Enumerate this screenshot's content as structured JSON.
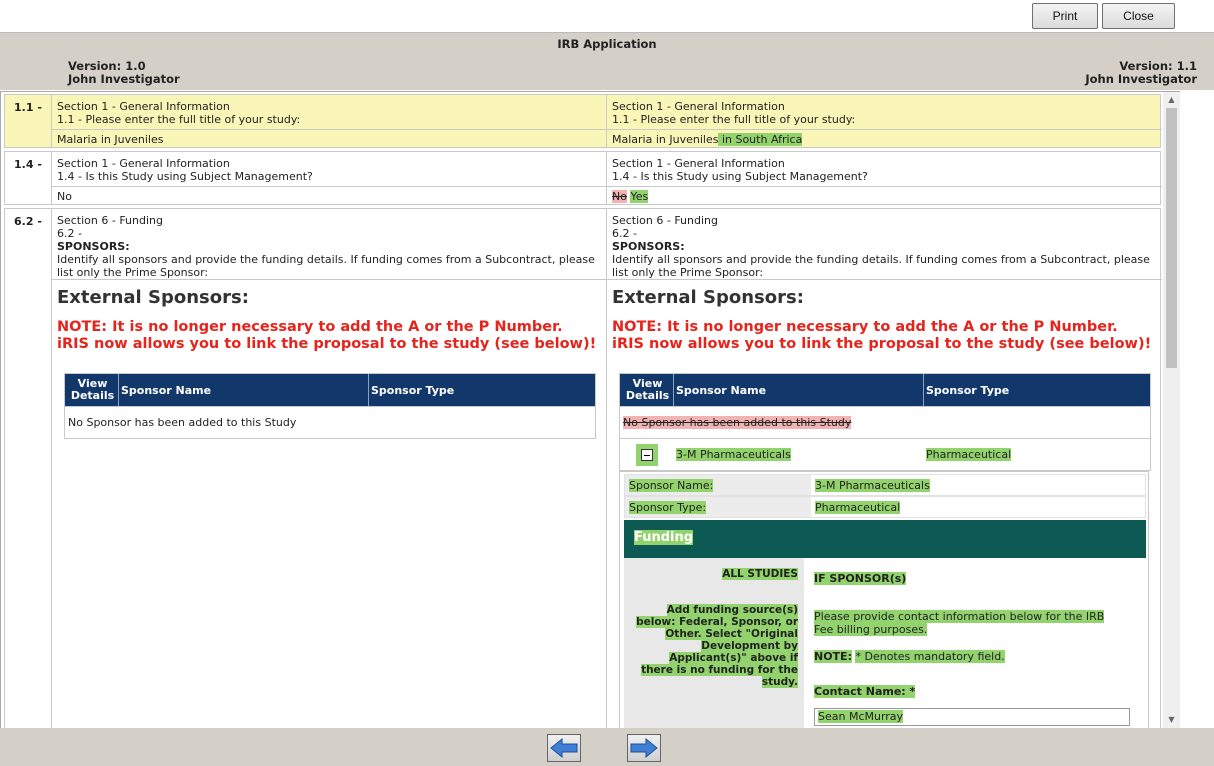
{
  "toolbar": {
    "print_label": "Print",
    "close_label": "Close"
  },
  "header": {
    "title": "IRB Application",
    "left_version": "Version: 1.0",
    "left_user": "John Investigator",
    "right_version": "Version: 1.1",
    "right_user": "John Investigator"
  },
  "rows": [
    {
      "num": "1.1 -",
      "left": {
        "section": "Section 1 - General Information",
        "question": "1.1 - Please enter the full title of your study:",
        "answer": "Malaria in Juveniles"
      },
      "right": {
        "section": "Section 1 - General Information",
        "question": "1.1 - Please enter the full title of your study:",
        "answer": "Malaria in Juveniles",
        "answer_added": " in South Africa"
      }
    },
    {
      "num": "1.4 -",
      "left": {
        "section": "Section 1 - General Information",
        "question": "1.4 - Is this Study using Subject Management?",
        "answer": "No"
      },
      "right": {
        "section": "Section 1 - General Information",
        "question": "1.4 - Is this Study using Subject Management?",
        "answer_removed": "No",
        "answer_added": "Yes"
      }
    },
    {
      "num": "6.2 -",
      "left": {
        "section": "Section 6 - Funding",
        "question": "6.2 -",
        "heading": "SPONSORS:",
        "instructions": "Identify all sponsors and provide the funding details. If funding comes from a Subcontract, please list only the Prime Sponsor:"
      },
      "right": {
        "section": "Section 6 - Funding",
        "question": "6.2 -",
        "heading": "SPONSORS:",
        "instructions": "Identify all sponsors and provide the funding details. If funding comes from a Subcontract, please list only the Prime Sponsor:"
      }
    }
  ],
  "sponsors": {
    "title": "External Sponsors:",
    "note": "NOTE: It is no longer necessary to add the A or the P Number. iRIS now allows you to link the proposal to the study (see below)!",
    "columns": [
      "View Details",
      "Sponsor Name",
      "Sponsor Type"
    ],
    "empty_text": "No Sponsor has been added to this Study",
    "added_sponsor": {
      "name": "3-M Pharmaceuticals",
      "type": "Pharmaceutical"
    },
    "detail": {
      "name_label": "Sponsor Name:",
      "name_value": "3-M Pharmaceuticals",
      "type_label": "Sponsor Type:",
      "type_value": "Pharmaceutical",
      "funding_title": "Funding",
      "all_studies": "ALL STUDIES",
      "add_funding_text": "Add funding source(s) below: Federal, Sponsor, or Other. Select \"Original Development by Applicant(s)\" above if there is no funding for the study.",
      "if_sponsor": "IF SPONSOR(s)",
      "contact_info": "Please provide contact information below for the IRB Fee billing purposes.",
      "note_label": "NOTE:",
      "note_text": "* Denotes mandatory field.",
      "contact_name_label": "Contact Name: *",
      "contact_name_value": "Sean McMurray"
    }
  },
  "icons": {
    "prev": "left-arrow-icon",
    "next": "right-arrow-icon",
    "collapse": "minus-box-icon"
  },
  "colors": {
    "added": "#92d36e",
    "removed": "#f2b3b3",
    "table_header": "#12386b",
    "funding_bar": "#0d5a55",
    "note": "#e8231c",
    "highlight_row": "#faf6b8"
  }
}
